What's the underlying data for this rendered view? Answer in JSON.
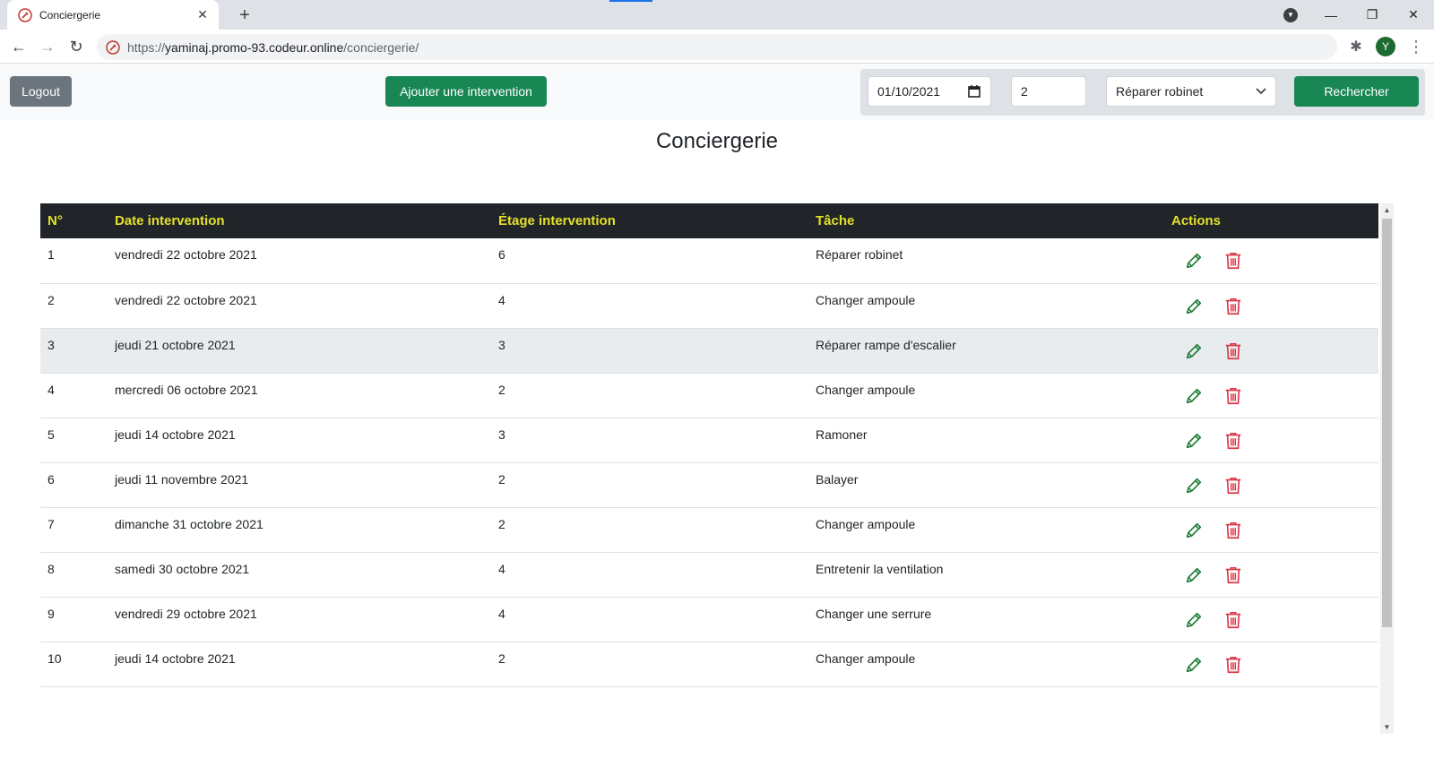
{
  "browser": {
    "tab_title": "Conciergerie",
    "url_prefix": "https://",
    "url_host": "yaminaj.promo-93.codeur.online",
    "url_path": "/conciergerie/",
    "avatar_letter": "Y"
  },
  "topbar": {
    "logout_label": "Logout",
    "add_label": "Ajouter une intervention",
    "date_value": "01/10/2021",
    "floor_value": "2",
    "task_select_value": "Réparer robinet",
    "search_label": "Rechercher"
  },
  "page_title": "Conciergerie",
  "table": {
    "headers": [
      "N°",
      "Date intervention",
      "Étage intervention",
      "Tâche",
      "Actions"
    ],
    "rows": [
      {
        "n": "1",
        "date": "vendredi 22 octobre 2021",
        "etage": "6",
        "tache": "Réparer robinet"
      },
      {
        "n": "2",
        "date": "vendredi 22 octobre 2021",
        "etage": "4",
        "tache": "Changer ampoule"
      },
      {
        "n": "3",
        "date": "jeudi 21 octobre 2021",
        "etage": "3",
        "tache": "Réparer rampe d'escalier"
      },
      {
        "n": "4",
        "date": "mercredi 06 octobre 2021",
        "etage": "2",
        "tache": "Changer ampoule"
      },
      {
        "n": "5",
        "date": "jeudi 14 octobre 2021",
        "etage": "3",
        "tache": "Ramoner"
      },
      {
        "n": "6",
        "date": "jeudi 11 novembre 2021",
        "etage": "2",
        "tache": "Balayer"
      },
      {
        "n": "7",
        "date": "dimanche 31 octobre 2021",
        "etage": "2",
        "tache": "Changer ampoule"
      },
      {
        "n": "8",
        "date": "samedi 30 octobre 2021",
        "etage": "4",
        "tache": "Entretenir la ventilation"
      },
      {
        "n": "9",
        "date": "vendredi 29 octobre 2021",
        "etage": "4",
        "tache": "Changer une serrure"
      },
      {
        "n": "10",
        "date": "jeudi 14 octobre 2021",
        "etage": "2",
        "tache": "Changer ampoule"
      }
    ]
  },
  "colors": {
    "header_bg": "#212529",
    "header_text": "#e3e02b",
    "success": "#198754",
    "secondary": "#6c757d",
    "edit_icon": "#1e7b34",
    "delete_icon": "#dc3545"
  },
  "icons": {
    "edit": "pencil-icon",
    "delete": "trash-icon"
  }
}
